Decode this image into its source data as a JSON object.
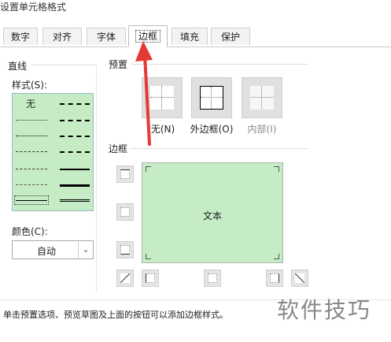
{
  "window": {
    "title": "设置单元格格式"
  },
  "tabs": [
    {
      "label": "数字"
    },
    {
      "label": "对齐"
    },
    {
      "label": "字体"
    },
    {
      "label": "边框"
    },
    {
      "label": "填充"
    },
    {
      "label": "保护"
    }
  ],
  "line_group": {
    "title": "直线",
    "style_label": "样式(S):",
    "none_label": "无",
    "color_label": "颜色(C):",
    "color_value": "自动"
  },
  "presets": {
    "title": "预置",
    "items": [
      {
        "label": "无(N)"
      },
      {
        "label": "外边框(O)"
      },
      {
        "label": "内部(I)"
      }
    ]
  },
  "border": {
    "title": "边框",
    "preview_text": "文本"
  },
  "hint": "单击预置选项、预览草图及上面的按钮可以添加边框样式。",
  "watermark": "软件技巧",
  "colors": {
    "preview_bg": "#c5ecc5",
    "arrow": "#e53935"
  }
}
